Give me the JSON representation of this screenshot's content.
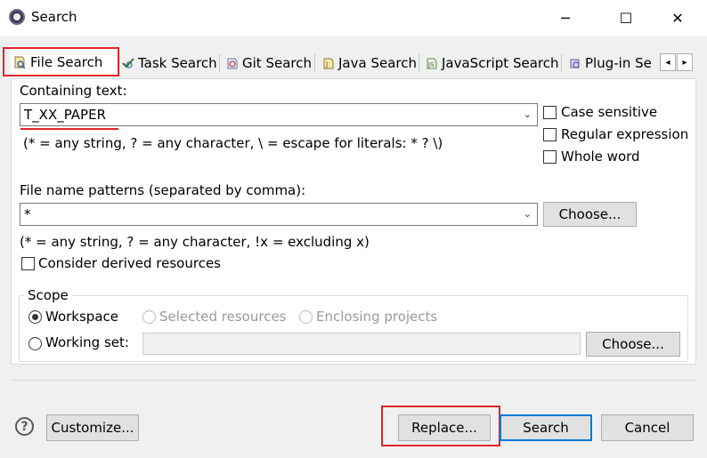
{
  "window": {
    "title": "Search",
    "minimize_glyph": "─",
    "maximize_glyph": "☐",
    "close_glyph": "✕"
  },
  "tabs": [
    {
      "label": "File Search",
      "icon": "file-search-icon",
      "active": true
    },
    {
      "label": "Task Search",
      "icon": "task-search-icon"
    },
    {
      "label": "Git Search",
      "icon": "git-search-icon"
    },
    {
      "label": "Java Search",
      "icon": "java-search-icon"
    },
    {
      "label": "JavaScript Search",
      "icon": "javascript-search-icon"
    },
    {
      "label": "Plug-in Se",
      "icon": "plugin-search-icon"
    }
  ],
  "tab_scroll": {
    "left": "◂",
    "right": "▸"
  },
  "containing_text": {
    "label": "Containing text:",
    "value": "T_XX_PAPER",
    "hint": "(* = any string, ? = any character, \\ = escape for literals: * ? \\)"
  },
  "options": {
    "case_sensitive": "Case sensitive",
    "regular_expression": "Regular expression",
    "whole_word": "Whole word"
  },
  "file_patterns": {
    "label": "File name patterns (separated by comma):",
    "value": "*",
    "choose_label": "Choose...",
    "hint": "(* = any string, ? = any character, !x = excluding x)",
    "derived_label": "Consider derived resources"
  },
  "scope": {
    "title": "Scope",
    "workspace": "Workspace",
    "selected_resources": "Selected resources",
    "enclosing_projects": "Enclosing projects",
    "working_set": "Working set:",
    "choose_label": "Choose..."
  },
  "footer": {
    "help_glyph": "?",
    "customize_label": "Customize...",
    "replace_label": "Replace...",
    "search_label": "Search",
    "cancel_label": "Cancel"
  },
  "colors": {
    "highlight": "#e0242b",
    "default_button_border": "#0078d7"
  }
}
